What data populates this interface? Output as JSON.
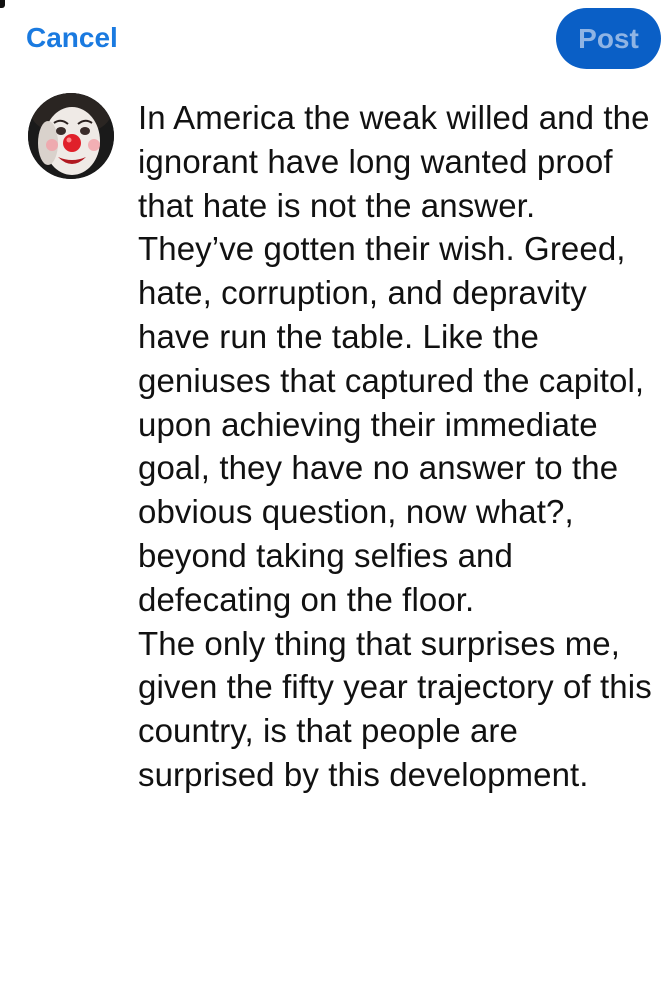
{
  "header": {
    "cancel_label": "Cancel",
    "post_label": "Post"
  },
  "colors": {
    "accent": "#1a7ae0",
    "post_button_bg": "#0a5fc6",
    "post_button_text": "#8fb4e4",
    "body_text": "#111111"
  },
  "avatar": {
    "icon": "clown-face-avatar"
  },
  "composer": {
    "paragraphs": [
      "In America the weak willed and the ignorant have long wanted proof that hate is not the answer. They’ve gotten their wish. Greed, hate, corruption, and depravity have run the table. Like the geniuses that captured the capitol, upon achieving their immediate goal, they have no answer to the obvious question, now what?, beyond taking selfies and defecating on the floor.",
      "The only thing that surprises me, given the fifty year trajectory of this country, is that people are surprised by this development."
    ]
  }
}
